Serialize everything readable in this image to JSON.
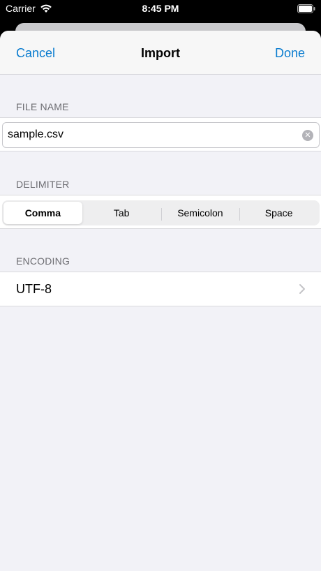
{
  "status_bar": {
    "carrier": "Carrier",
    "time": "8:45 PM"
  },
  "nav": {
    "cancel_label": "Cancel",
    "title": "Import",
    "done_label": "Done",
    "accent_color": "#0a7ccf"
  },
  "file_name": {
    "header": "FILE NAME",
    "value": "sample.csv"
  },
  "delimiter": {
    "header": "DELIMITER",
    "options": [
      "Comma",
      "Tab",
      "Semicolon",
      "Space"
    ],
    "selected": "Comma"
  },
  "encoding": {
    "header": "ENCODING",
    "value": "UTF-8"
  },
  "icons": {
    "wifi": "wifi-icon",
    "battery": "battery-icon",
    "clear": "clear-icon",
    "chevron": "chevron-right-icon"
  }
}
